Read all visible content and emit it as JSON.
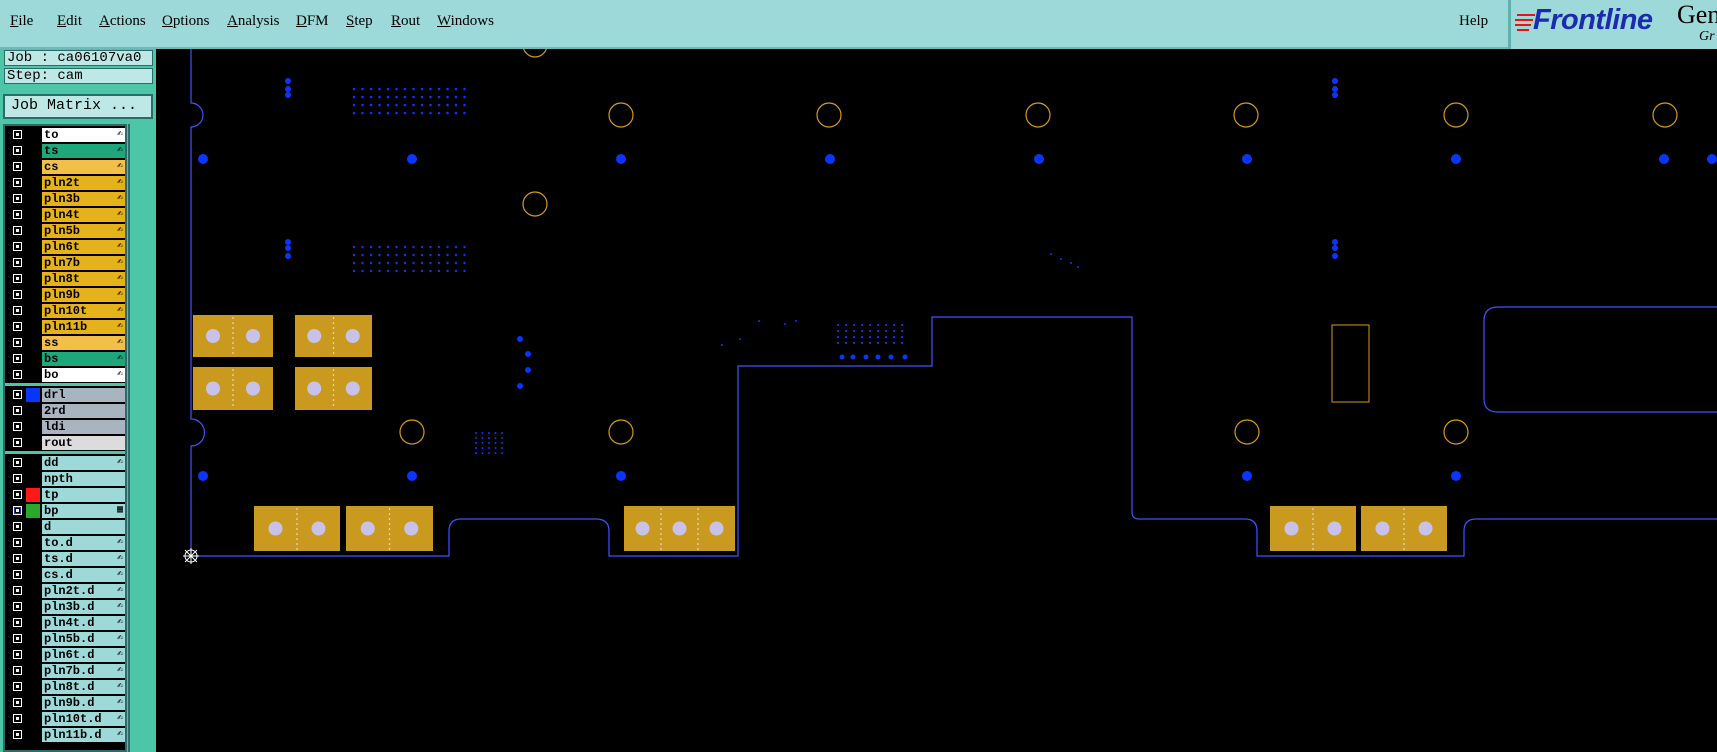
{
  "menubar": {
    "items": [
      {
        "label": "File",
        "name": "menu-file"
      },
      {
        "label": "Edit",
        "name": "menu-edit"
      },
      {
        "label": "Actions",
        "name": "menu-actions"
      },
      {
        "label": "Options",
        "name": "menu-options"
      },
      {
        "label": "Analysis",
        "name": "menu-analysis"
      },
      {
        "label": "DFM",
        "name": "menu-dfm"
      },
      {
        "label": "Step",
        "name": "menu-step"
      },
      {
        "label": "Rout",
        "name": "menu-rout"
      },
      {
        "label": "Windows",
        "name": "menu-windows"
      }
    ],
    "help_label": "Help"
  },
  "logo": {
    "brand": "Frontline",
    "extra": "Gen",
    "sub": "Gr"
  },
  "panel": {
    "job": "Job : ca06107va0",
    "step": "Step: cam",
    "job_matrix_label": "Job Matrix ...",
    "layers": [
      {
        "name": "to",
        "color": "#ffffff",
        "mark": "✍"
      },
      {
        "name": "ts",
        "color": "#1fa67b",
        "mark": "✍"
      },
      {
        "name": "cs",
        "color": "#f2c04a",
        "mark": "✍"
      },
      {
        "name": "pln2t",
        "color": "#e6b21c",
        "mark": "✍"
      },
      {
        "name": "pln3b",
        "color": "#e6b21c",
        "mark": "✍"
      },
      {
        "name": "pln4t",
        "color": "#e6b21c",
        "mark": "✍"
      },
      {
        "name": "pln5b",
        "color": "#e6b21c",
        "mark": "✍"
      },
      {
        "name": "pln6t",
        "color": "#e6b21c",
        "mark": "✍"
      },
      {
        "name": "pln7b",
        "color": "#e6b21c",
        "mark": "✍"
      },
      {
        "name": "pln8t",
        "color": "#e6b21c",
        "mark": "✍"
      },
      {
        "name": "pln9b",
        "color": "#e6b21c",
        "mark": "✍"
      },
      {
        "name": "pln10t",
        "color": "#e6b21c",
        "mark": "✍"
      },
      {
        "name": "pln11b",
        "color": "#e6b21c",
        "mark": "✍"
      },
      {
        "name": "ss",
        "color": "#f2c04a",
        "mark": "✍"
      },
      {
        "name": "bs",
        "color": "#1fa67b",
        "mark": "✍"
      },
      {
        "name": "bo",
        "color": "#ffffff",
        "mark": "✍"
      }
    ],
    "drill_layers": [
      {
        "name": "drl",
        "color": "#a8b4c0",
        "swatch": "#0a35ff"
      },
      {
        "name": "2rd",
        "color": "#a8b4c0",
        "swatch": ""
      },
      {
        "name": "ldi",
        "color": "#a8b4c0",
        "swatch": ""
      },
      {
        "name": "rout",
        "color": "#dcdcdc",
        "swatch": ""
      }
    ],
    "misc_layers": [
      {
        "name": "dd",
        "color": "#9dd9d8",
        "swatch": "",
        "mark": "✍"
      },
      {
        "name": "npth",
        "color": "#9dd9d8",
        "swatch": "",
        "mark": ""
      },
      {
        "name": "tp",
        "color": "#9dd9d8",
        "swatch": "#ff1a1a",
        "mark": ""
      },
      {
        "name": "bp",
        "color": "#9dd9d8",
        "swatch": "#2aa82a",
        "mark": "▦"
      },
      {
        "name": "d",
        "color": "#9dd9d8",
        "swatch": "",
        "mark": ""
      },
      {
        "name": "to.d",
        "color": "#9dd9d8",
        "swatch": "",
        "mark": "✍"
      },
      {
        "name": "ts.d",
        "color": "#9dd9d8",
        "swatch": "",
        "mark": "✍"
      },
      {
        "name": "cs.d",
        "color": "#9dd9d8",
        "swatch": "",
        "mark": "✍"
      },
      {
        "name": "pln2t.d",
        "color": "#9dd9d8",
        "swatch": "",
        "mark": "✍"
      },
      {
        "name": "pln3b.d",
        "color": "#9dd9d8",
        "swatch": "",
        "mark": "✍"
      },
      {
        "name": "pln4t.d",
        "color": "#9dd9d8",
        "swatch": "",
        "mark": "✍"
      },
      {
        "name": "pln5b.d",
        "color": "#9dd9d8",
        "swatch": "",
        "mark": "✍"
      },
      {
        "name": "pln6t.d",
        "color": "#9dd9d8",
        "swatch": "",
        "mark": "✍"
      },
      {
        "name": "pln7b.d",
        "color": "#9dd9d8",
        "swatch": "",
        "mark": "✍"
      },
      {
        "name": "pln8t.d",
        "color": "#9dd9d8",
        "swatch": "",
        "mark": "✍"
      },
      {
        "name": "pln9b.d",
        "color": "#9dd9d8",
        "swatch": "",
        "mark": "✍"
      },
      {
        "name": "pln10t.d",
        "color": "#9dd9d8",
        "swatch": "",
        "mark": "✍"
      },
      {
        "name": "pln11b.d",
        "color": "#9dd9d8",
        "swatch": "",
        "mark": "✍"
      }
    ]
  },
  "colors": {
    "outline": "#3a55ff",
    "drill": "#0a35ff",
    "pad": "#c99a1d",
    "ring": "#d59a1c"
  }
}
